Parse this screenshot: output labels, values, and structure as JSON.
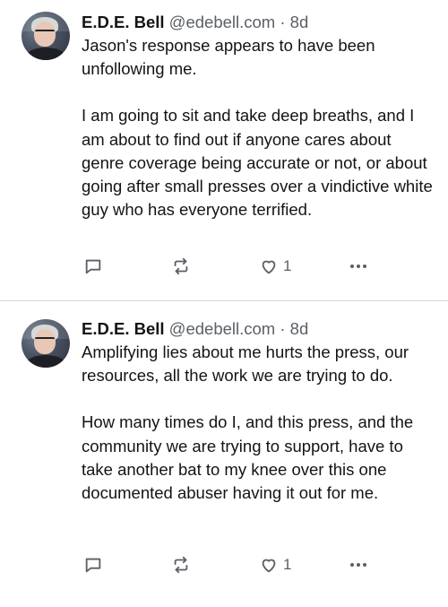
{
  "posts": [
    {
      "author": {
        "name": "E.D.E. Bell",
        "handle": "@edebell.com",
        "separator": "·",
        "time": "8d"
      },
      "paragraphs": [
        "Jason's response appears to have been unfollowing me.",
        "I am going to sit and take deep breaths, and I am about to find out if anyone cares about genre coverage being accurate or not, or about going after small presses over a vindictive white guy who has everyone terrified."
      ],
      "actions": {
        "reply_icon": "reply-icon",
        "boost_icon": "boost-icon",
        "favorite_icon": "heart-icon",
        "favorite_count": "1",
        "more_icon": "more-icon"
      }
    },
    {
      "author": {
        "name": "E.D.E. Bell",
        "handle": "@edebell.com",
        "separator": "·",
        "time": "8d"
      },
      "paragraphs": [
        "Amplifying lies about me hurts the press, our resources, all the work we are trying to do.",
        "How many times do I, and this press, and the community we are trying to support, have to take another bat to my knee over this one documented abuser having it out for me."
      ],
      "actions": {
        "reply_icon": "reply-icon",
        "boost_icon": "boost-icon",
        "favorite_icon": "heart-icon",
        "favorite_count": "1",
        "more_icon": "more-icon"
      }
    }
  ],
  "colors": {
    "text": "#141414",
    "muted": "#5b5f66",
    "divider": "#d7d7dc",
    "background": "#ffffff"
  }
}
